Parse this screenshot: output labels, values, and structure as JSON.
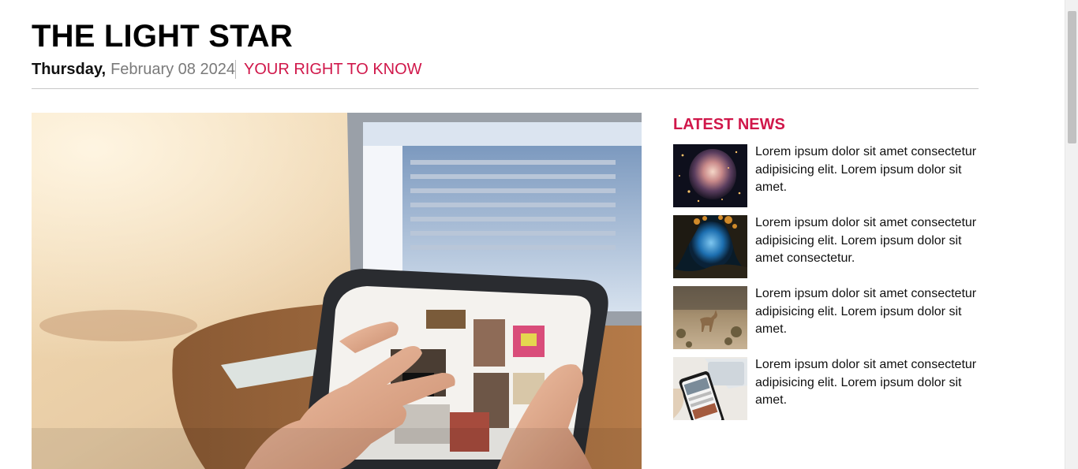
{
  "header": {
    "title": "THE LIGHT STAR",
    "day": "Thursday,",
    "date": "February 08 2024",
    "tagline": "YOUR RIGHT TO KNOW"
  },
  "colors": {
    "accent": "#d0174a",
    "date_gray": "#7a7a7a",
    "rule": "#c8c8c8"
  },
  "sidebar": {
    "heading": "LATEST NEWS",
    "items": [
      {
        "text": "Lorem ipsum dolor sit amet consectetur adipisicing elit. Lorem ipsum dolor sit amet.",
        "image": "nebula-image"
      },
      {
        "text": "Lorem ipsum dolor sit amet consectetur adipisicing elit. Lorem ipsum dolor sit amet consectetur.",
        "image": "underwater-cave-image"
      },
      {
        "text": "Lorem ipsum dolor sit amet consectetur adipisicing elit. Lorem ipsum dolor sit amet.",
        "image": "deer-image"
      },
      {
        "text": "Lorem ipsum dolor sit amet consectetur adipisicing elit. Lorem ipsum dolor sit amet.",
        "image": "phones-image"
      }
    ]
  },
  "hero": {
    "image": "tablet-laptop-photo"
  }
}
